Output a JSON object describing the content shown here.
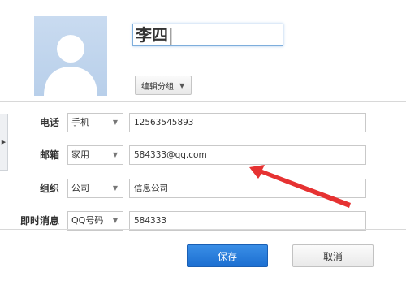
{
  "contact": {
    "name": "李四",
    "group_button_label": "编辑分组"
  },
  "fields": [
    {
      "label": "电话",
      "type": "手机",
      "value": "12563545893"
    },
    {
      "label": "邮箱",
      "type": "家用",
      "value": "584333@qq.com"
    },
    {
      "label": "组织",
      "type": "公司",
      "value": "信息公司"
    },
    {
      "label": "即时消息",
      "type": "QQ号码",
      "value": "584333"
    }
  ],
  "actions": {
    "save_label": "保存",
    "cancel_label": "取消"
  },
  "colors": {
    "primary_button": "#1c6fd1",
    "annotation_arrow": "#e63232",
    "avatar_bg": "#c0d5ee"
  }
}
